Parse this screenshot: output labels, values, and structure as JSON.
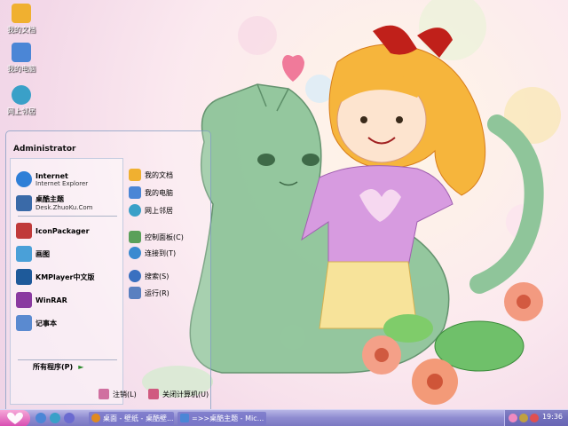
{
  "desktop": {
    "icons": [
      {
        "label": "我的文档",
        "color": "#f0b030"
      },
      {
        "label": "我的电脑",
        "color": "#4b86d6"
      },
      {
        "label": "网上邻居",
        "color": "#3aa0c8"
      }
    ]
  },
  "start_menu": {
    "user": "Administrator",
    "pinned": [
      {
        "title": "Internet",
        "subtitle": "Internet Explorer",
        "color": "#2f7fd7"
      },
      {
        "title": "桌酷主题",
        "subtitle": "Desk.ZhuoKu.Com",
        "color": "#3a6aa8"
      }
    ],
    "recent": [
      {
        "title": "IconPackager",
        "color": "#c03a3a"
      },
      {
        "title": "画图",
        "color": "#4aa0d8"
      },
      {
        "title": "KMPlayer中文版",
        "color": "#1e5a9a"
      },
      {
        "title": "WinRAR",
        "color": "#8a3aa0"
      },
      {
        "title": "记事本",
        "color": "#5a8ad0"
      }
    ],
    "all_programs": "所有程序(P)",
    "right_items": [
      {
        "label": "我的文档",
        "color": "#f0b030"
      },
      {
        "label": "我的电脑",
        "color": "#4b86d6"
      },
      {
        "label": "网上邻居",
        "color": "#3aa0c8"
      },
      {
        "label": "控制面板(C)",
        "color": "#5aa05a"
      },
      {
        "label": "连接到(T)",
        "color": "#3a8ad0"
      },
      {
        "label": "搜索(S)",
        "color": "#3a70c0"
      },
      {
        "label": "运行(R)",
        "color": "#5a80c0"
      }
    ],
    "logoff": "注销(L)",
    "shutdown": "关闭计算机(U)"
  },
  "taskbar": {
    "tasks": [
      {
        "label": "桌面 - 壁纸 - 桌酷壁...",
        "color": "#e08a20"
      },
      {
        "label": "=>>桌酷主题 - Mic...",
        "color": "#4b86d6"
      }
    ],
    "clock": "19:36"
  }
}
